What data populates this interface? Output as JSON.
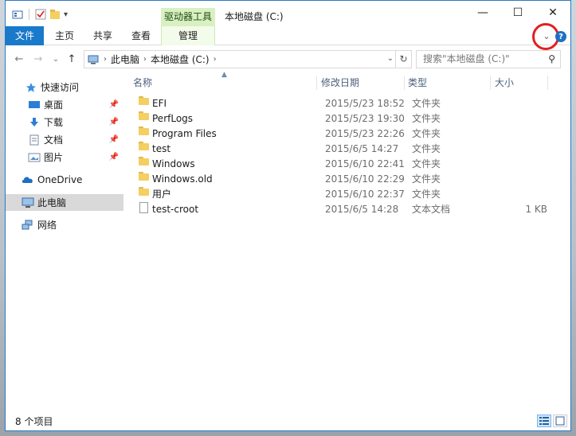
{
  "window": {
    "title": "本地磁盘 (C:)",
    "tool_tab": "驱动器工具",
    "controls": {
      "minimize": "—",
      "maximize": "☐",
      "close": "✕"
    }
  },
  "ribbon": {
    "tabs": [
      {
        "label": "文件"
      },
      {
        "label": "主页"
      },
      {
        "label": "共享"
      },
      {
        "label": "查看"
      },
      {
        "label": "管理"
      }
    ],
    "expand_glyph": "⌄",
    "help_glyph": "?"
  },
  "navigation": {
    "back": "←",
    "forward": "→",
    "recent": "⌄",
    "up": "↑",
    "address": [
      "此电脑",
      "本地磁盘 (C:)"
    ],
    "search_placeholder": "搜索\"本地磁盘 (C:)\"",
    "search_glyph": "⚲",
    "refresh_glyph": "↻"
  },
  "nav_pane": {
    "quick_access": "快速访问",
    "quick_items": [
      {
        "label": "桌面",
        "icon": "desktop-icon"
      },
      {
        "label": "下载",
        "icon": "download-icon"
      },
      {
        "label": "文档",
        "icon": "document-icon"
      },
      {
        "label": "图片",
        "icon": "picture-icon"
      }
    ],
    "onedrive": "OneDrive",
    "this_pc": "此电脑",
    "network": "网络"
  },
  "columns": {
    "name": "名称",
    "date": "修改日期",
    "type": "类型",
    "size": "大小"
  },
  "files": [
    {
      "name": "EFI",
      "date": "2015/5/23 18:52",
      "type": "文件夹",
      "size": "",
      "kind": "folder"
    },
    {
      "name": "PerfLogs",
      "date": "2015/5/23 19:30",
      "type": "文件夹",
      "size": "",
      "kind": "folder"
    },
    {
      "name": "Program Files",
      "date": "2015/5/23 22:26",
      "type": "文件夹",
      "size": "",
      "kind": "folder"
    },
    {
      "name": "test",
      "date": "2015/6/5 14:27",
      "type": "文件夹",
      "size": "",
      "kind": "folder"
    },
    {
      "name": "Windows",
      "date": "2015/6/10 22:41",
      "type": "文件夹",
      "size": "",
      "kind": "folder"
    },
    {
      "name": "Windows.old",
      "date": "2015/6/10 22:29",
      "type": "文件夹",
      "size": "",
      "kind": "folder"
    },
    {
      "name": "用户",
      "date": "2015/6/10 22:37",
      "type": "文件夹",
      "size": "",
      "kind": "folder"
    },
    {
      "name": "test-croot",
      "date": "2015/6/5 14:28",
      "type": "文本文档",
      "size": "1 KB",
      "kind": "text"
    }
  ],
  "status": {
    "count": "8 个项目"
  },
  "colors": {
    "file_tab": "#1979ca",
    "tool_tab": "#d9f0c2",
    "folder": "#f4cf61",
    "highlight_circle": "#e02020"
  }
}
